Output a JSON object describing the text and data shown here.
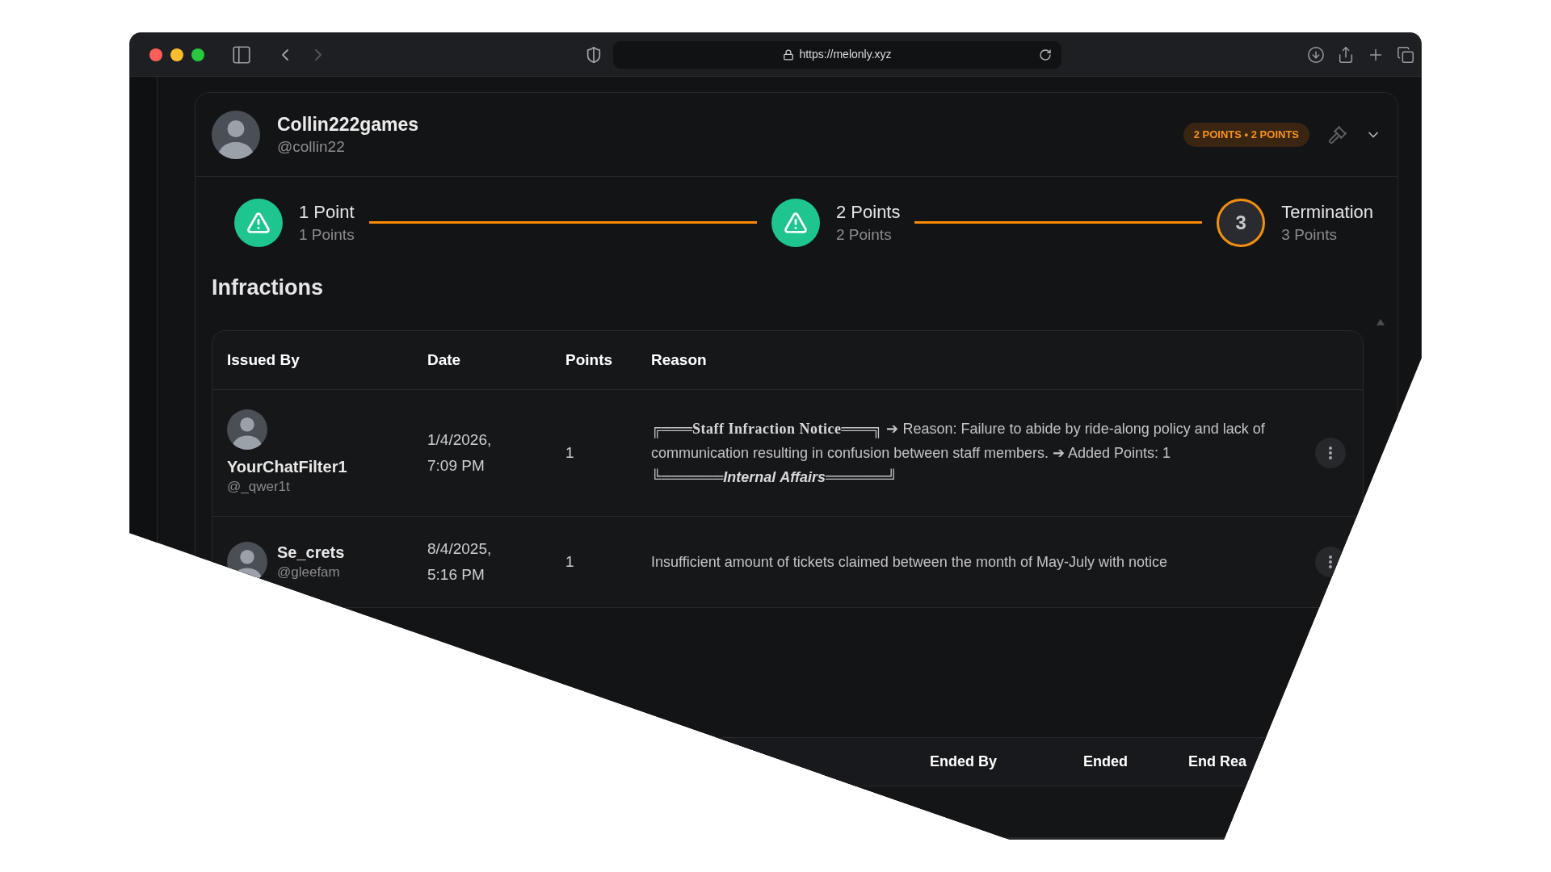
{
  "browser": {
    "url": "https://melonly.xyz"
  },
  "profile": {
    "name": "Collin222games",
    "handle": "@collin22",
    "badge": "2 POINTS • 2 POINTS"
  },
  "timeline": [
    {
      "title": "1 Point",
      "subtitle": "1 Points",
      "reached": true
    },
    {
      "title": "2 Points",
      "subtitle": "2 Points",
      "reached": true
    },
    {
      "number": "3",
      "title": "Termination",
      "subtitle": "3 Points",
      "reached": false
    }
  ],
  "infractions": {
    "title": "Infractions",
    "columns": [
      "Issued By",
      "Date",
      "Points",
      "Reason"
    ],
    "rows": [
      {
        "issuer": {
          "name": "YourChatFilter1",
          "handle": "@_qwer1t"
        },
        "date": "1/4/2026, 7:09 PM",
        "points": "1",
        "reason": "╔═══**Staff Infraction Notice**═══╗ ➔ Reason: Failure to abide by ride-along policy and lack of communication resulting in confusion between staff members. ➔ Added Points: 1 ╚══════**Internal Affairs**══════╝"
      },
      {
        "issuer": {
          "name": "Se_crets",
          "handle": "@gleefam"
        },
        "date": "8/4/2025, 5:16 PM",
        "points": "1",
        "reason": "Insufficient amount of tickets claimed between the month of May-July with notice"
      }
    ]
  },
  "ended_infractions": {
    "columns": [
      "Ended By",
      "Ended",
      "End Rea"
    ]
  }
}
